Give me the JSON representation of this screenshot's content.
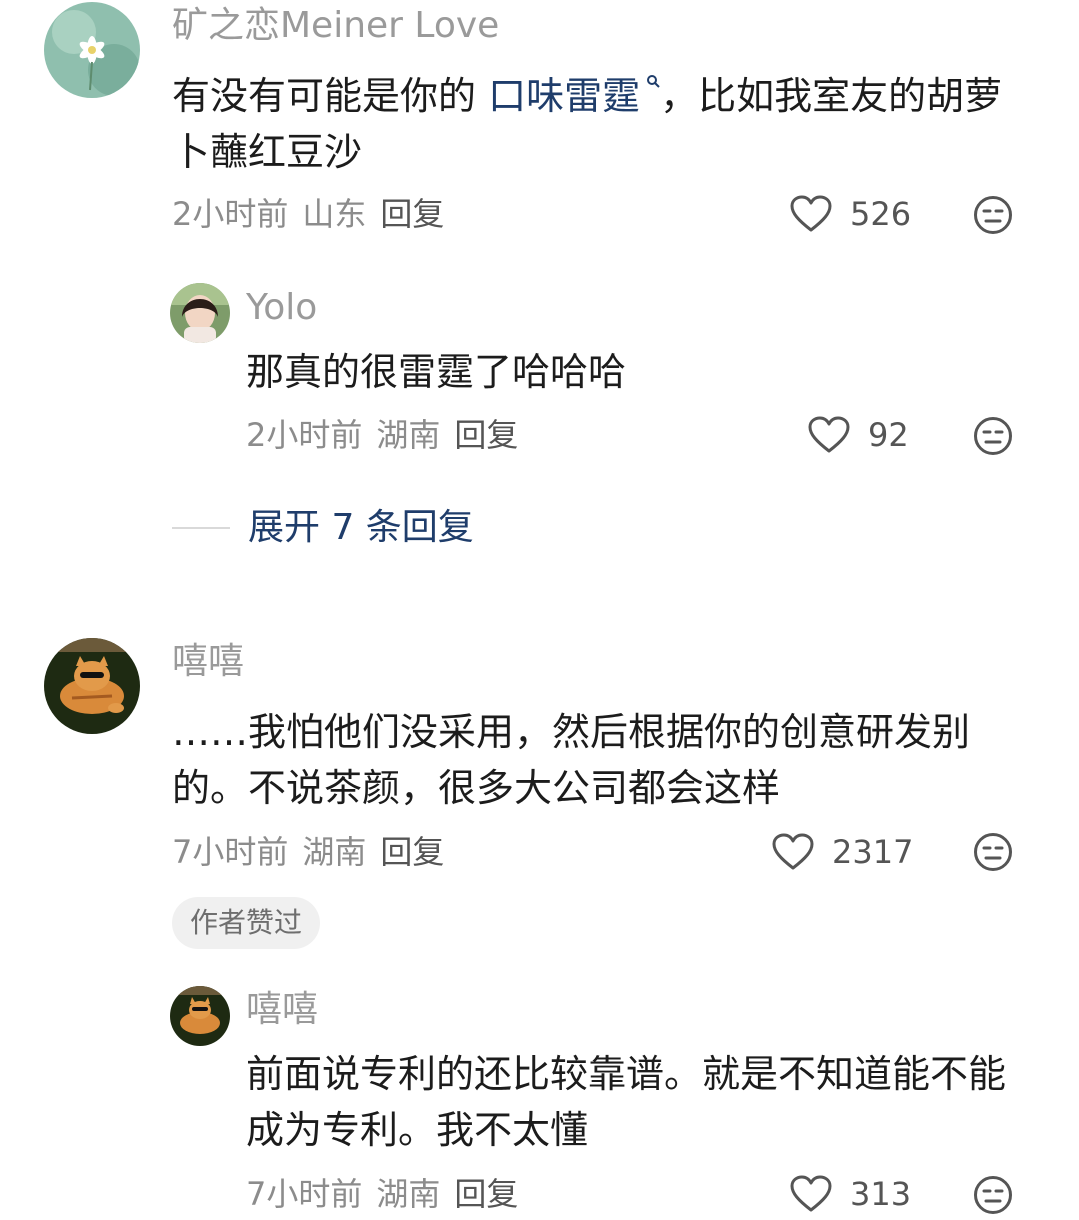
{
  "comments": [
    {
      "username": "矿之恋Meiner Love",
      "content_prefix": "有没有可能是你的",
      "content_link": "口味雷霆",
      "content_suffix": "，比如我室友的胡萝卜蘸红豆沙",
      "time": "2小时前",
      "location": "山东",
      "reply_label": "回复",
      "likes": "526",
      "replies": [
        {
          "username": "Yolo",
          "content": "那真的很雷霆了哈哈哈",
          "time": "2小时前",
          "location": "湖南",
          "reply_label": "回复",
          "likes": "92"
        }
      ],
      "expand_label": "展开 7 条回复"
    },
    {
      "username": "嘻嘻",
      "content": "……我怕他们没采用，然后根据你的创意研发别的。不说茶颜，很多大公司都会这样",
      "time": "7小时前",
      "location": "湖南",
      "reply_label": "回复",
      "likes": "2317",
      "badge": "作者赞过",
      "replies": [
        {
          "username": "嘻嘻",
          "content": "前面说专利的还比较靠谱。就是不知道能不能成为专利。我不太懂",
          "time": "7小时前",
          "location": "湖南",
          "reply_label": "回复",
          "likes": "313"
        }
      ]
    }
  ],
  "icons": {
    "like": "heart-outline-icon",
    "dislike": "neutral-face-icon",
    "search": "search-icon"
  },
  "colors": {
    "link": "#1f3d6b",
    "meta": "#8c8c8c",
    "username": "#9a9a9a"
  }
}
